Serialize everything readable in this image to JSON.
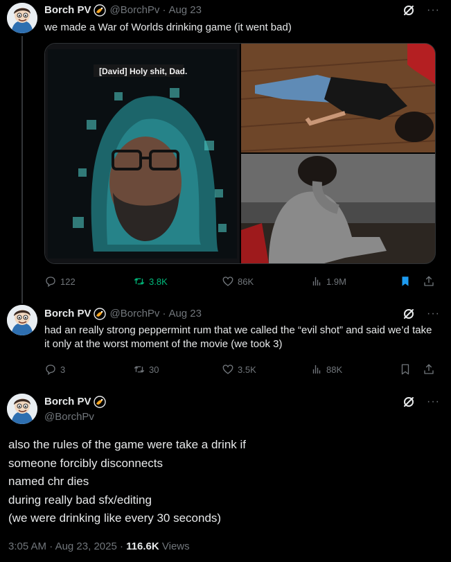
{
  "post1": {
    "name": "Borch PV",
    "handle": "@BorchPv",
    "date": "Aug 23",
    "text": "we made a War of Worlds drinking game (it went bad)",
    "subtitle": "[David] Holy shit, Dad.",
    "replies": "122",
    "reposts": "3.8K",
    "likes": "86K",
    "views": "1.9M",
    "bookmarked": true
  },
  "post2": {
    "name": "Borch PV",
    "handle": "@BorchPv",
    "date": "Aug 23",
    "text": "had an really strong peppermint rum that we called the “evil shot” and said we’d take it only at the worst moment of the movie (we took 3)",
    "replies": "3",
    "reposts": "30",
    "likes": "3.5K",
    "views": "88K",
    "bookmarked": false
  },
  "post3": {
    "name": "Borch PV",
    "handle": "@BorchPv",
    "lines": [
      "also the rules of the game were take a drink if",
      "someone forcibly disconnects",
      "named chr dies",
      "during really bad sfx/editing",
      "(we were drinking like every 30 seconds)"
    ],
    "time": "3:05 AM",
    "full_date": "Aug 23, 2025",
    "views_count": "116.6K",
    "views_label": "Views"
  },
  "icons": [
    "reply-icon",
    "repost-icon",
    "like-icon",
    "views-icon",
    "bookmark-icon",
    "share-icon",
    "grok-icon",
    "more-icon"
  ],
  "colors": {
    "background": "#000000",
    "text": "#e7e9ea",
    "muted": "#71767b",
    "repost": "#00ba7c",
    "bookmark": "#1d9bf0",
    "divider": "#2f3336"
  }
}
